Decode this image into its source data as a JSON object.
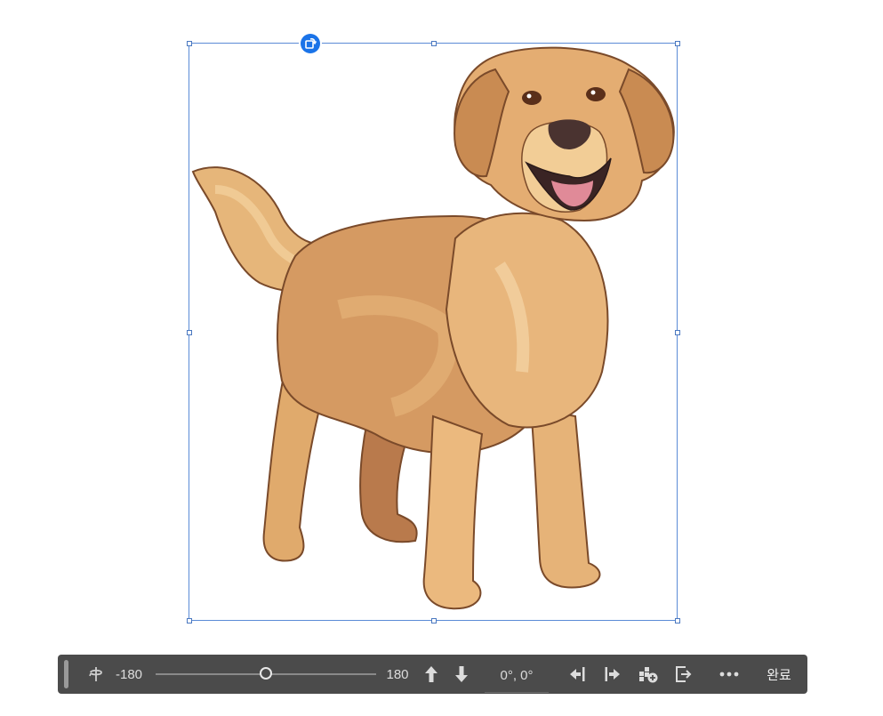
{
  "rotation_toolbar": {
    "min_label": "-180",
    "max_label": "180",
    "slider_value_fraction": 0.5,
    "angle_readout": "0°, 0°",
    "done_label": "완료"
  },
  "colors": {
    "selection_border": "#5b8bd6",
    "rotate_handle": "#1a73e8",
    "toolbar_bg": "#4b4b4b"
  },
  "icons": {
    "rotate_handle": "rotate-icon",
    "rotation_axis": "rotation-axis-icon",
    "move_up": "arrow-up-icon",
    "move_down": "arrow-down-icon",
    "align_left": "align-left-icon",
    "align_right": "align-right-icon",
    "add": "add-icon",
    "export": "export-icon",
    "more": "more-icon"
  }
}
